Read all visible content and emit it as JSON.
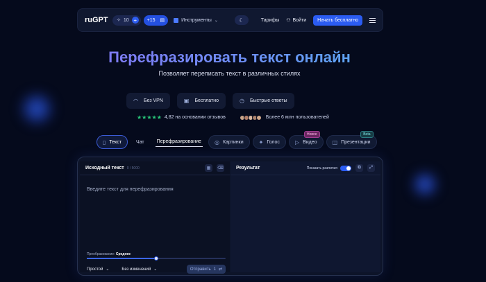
{
  "header": {
    "logo": "ruGPT",
    "credits": "10",
    "bonus": "+15",
    "tools_label": "Инструменты",
    "pricing_label": "Тарифы",
    "login_label": "Войти",
    "cta_label": "Начать бесплатно"
  },
  "hero": {
    "title": "Перефразировать текст онлайн",
    "subtitle": "Позволяет переписать текст в различных стилях"
  },
  "features": [
    {
      "label": "Без VPN",
      "icon": "wifi-icon"
    },
    {
      "label": "Бесплатно",
      "icon": "wallet-icon"
    },
    {
      "label": "Быстрые ответы",
      "icon": "timer-icon"
    }
  ],
  "rating": {
    "stars": 4.82,
    "text": "4,82 на основании отзывов",
    "users_text": "Более 6 млн пользователей"
  },
  "modes": {
    "text": "Текст",
    "chat": "Чат",
    "paraphrase": "Перефразирование",
    "images": "Картинки",
    "voice": "Голос",
    "video": "Видео",
    "video_badge": "Новое",
    "presentations": "Презентации",
    "presentations_badge": "Beta"
  },
  "editor": {
    "source_title": "Исходный текст",
    "counter": "0 / 5000",
    "placeholder": "Введите текст для перефразирования",
    "paraphrase_label": "Преобразование:",
    "paraphrase_level": "Среднее",
    "paraphrase_level_fraction": 0.5,
    "style_value": "Простой",
    "changes_value": "Без изменений",
    "send_label": "Отправить",
    "send_count": "1",
    "result_title": "Результат",
    "show_diff_label": "Показать различия",
    "show_diff_on": true
  },
  "colors": {
    "accent": "#2b5cf2",
    "background": "#050a1c",
    "star_green": "#28c87a"
  }
}
